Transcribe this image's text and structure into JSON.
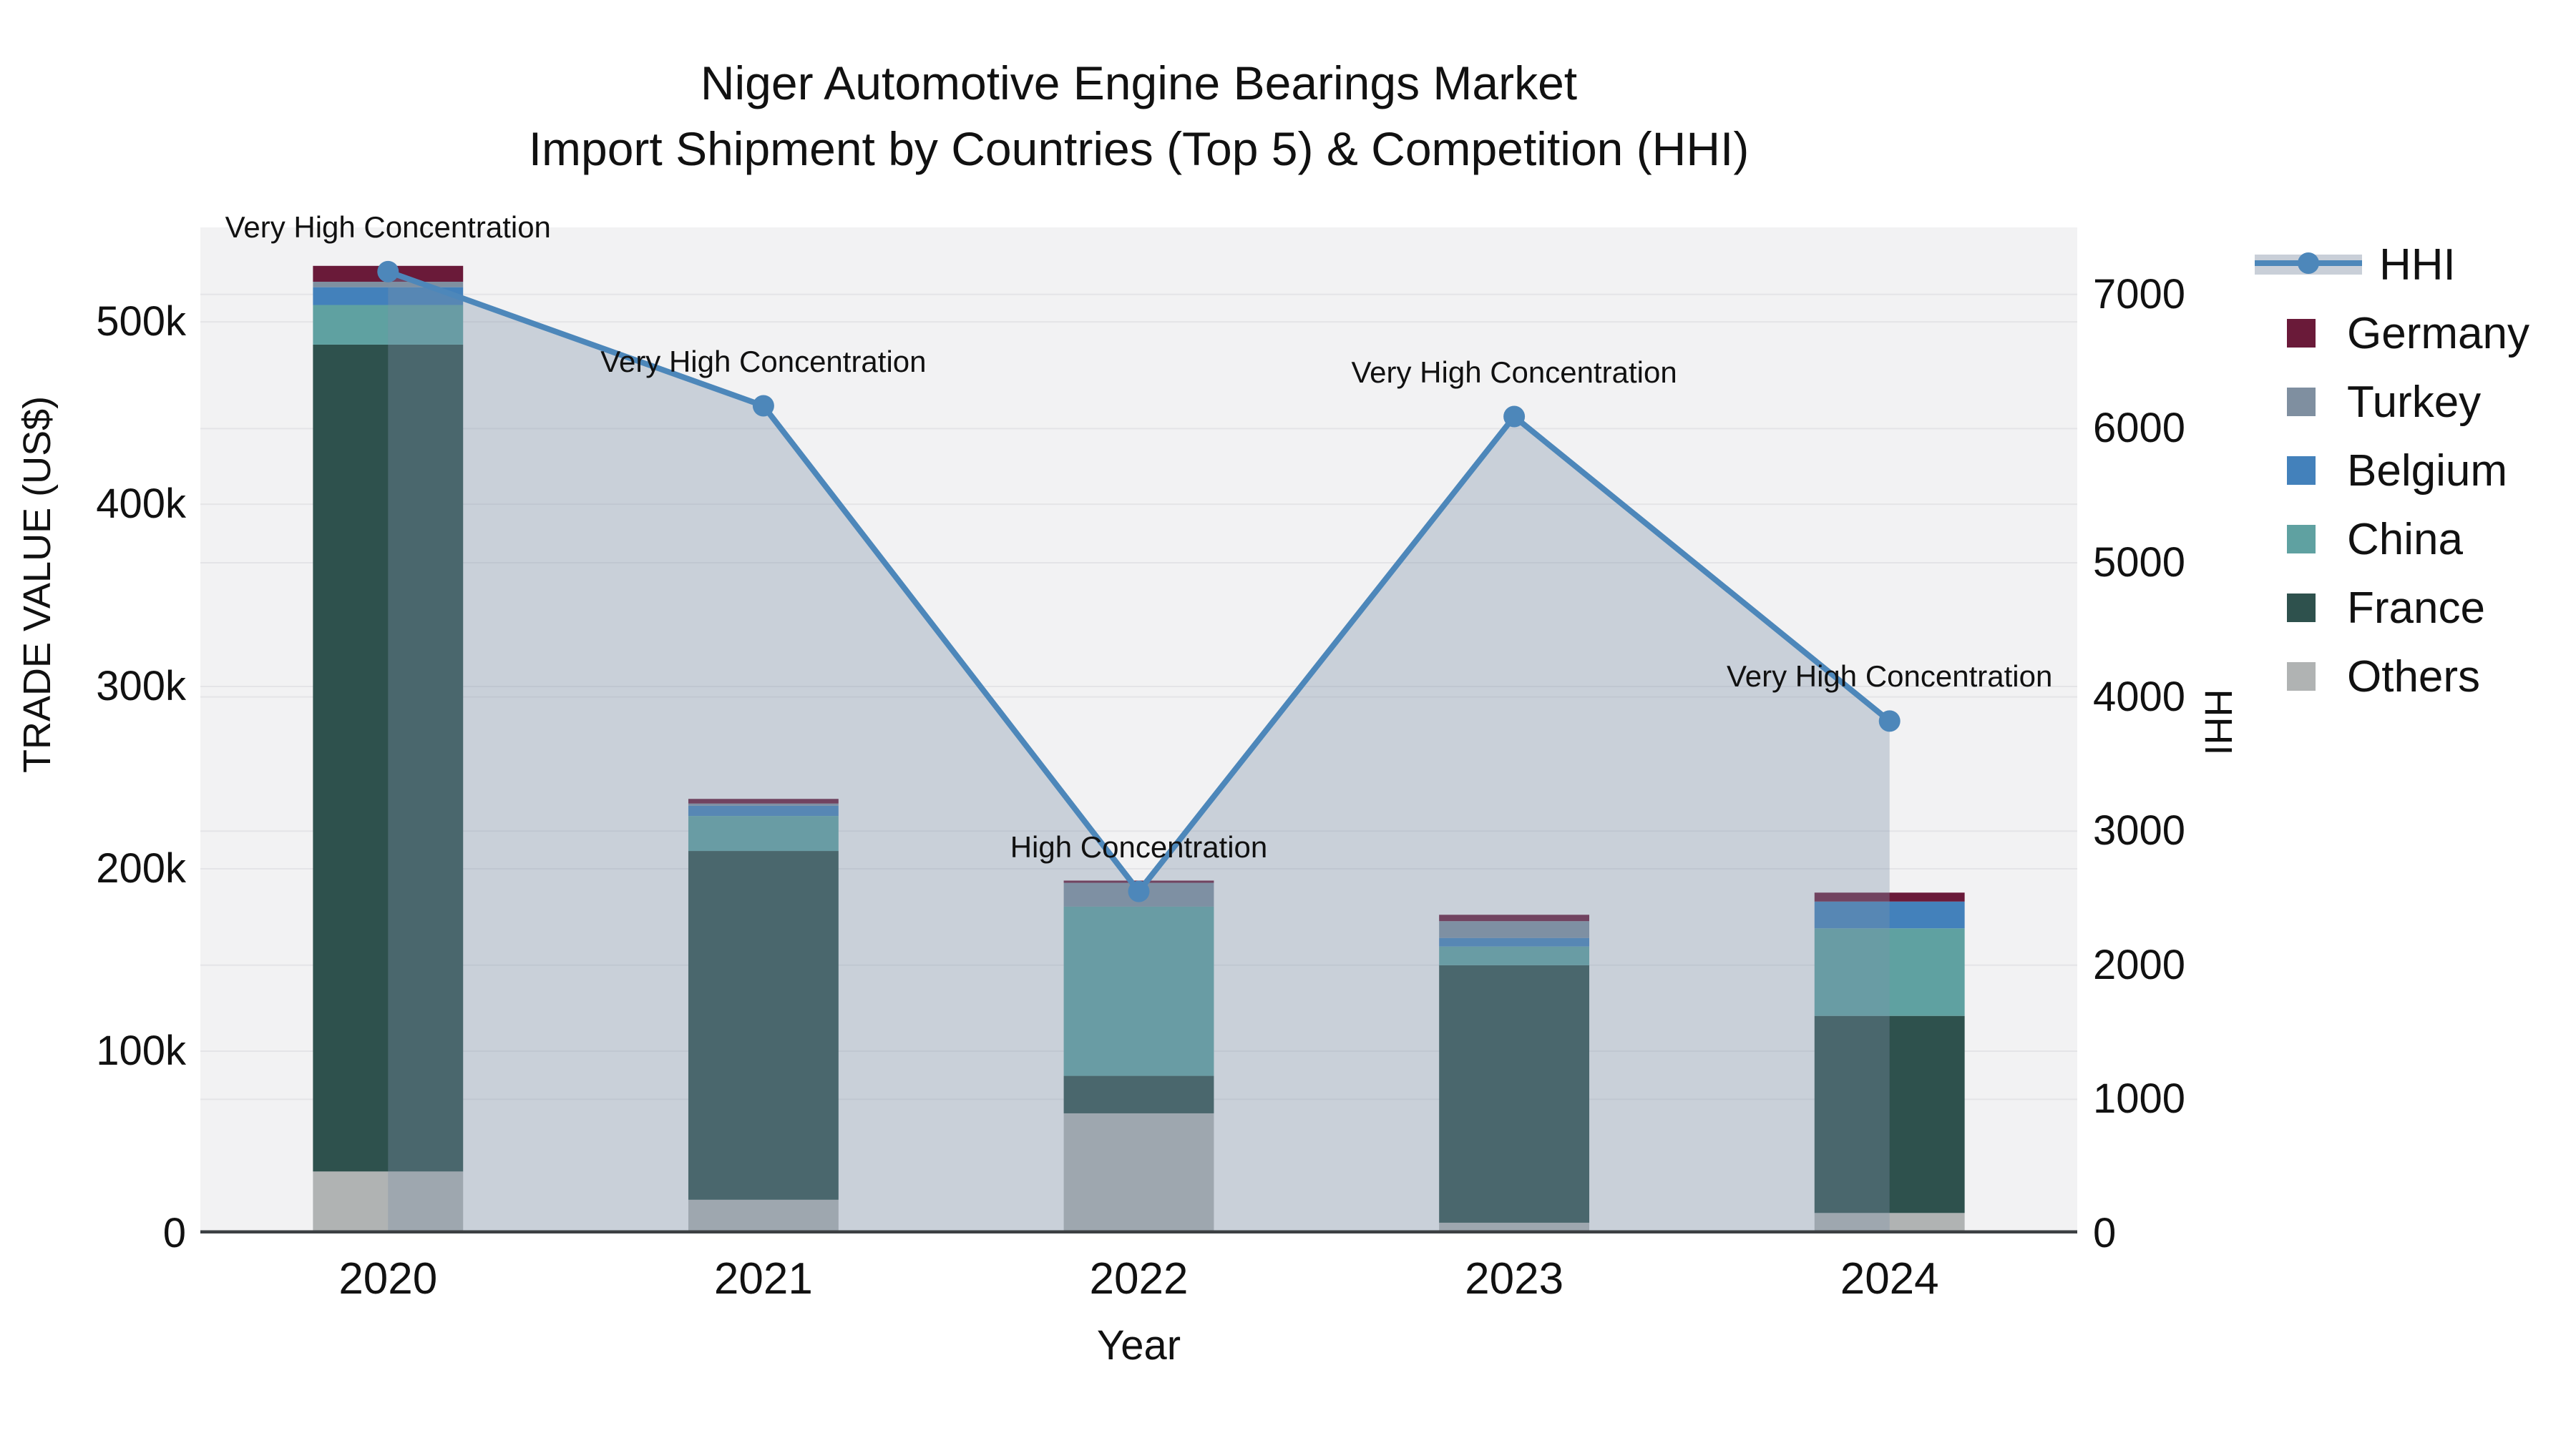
{
  "title": {
    "line1": "Niger Automotive Engine Bearings Market",
    "line2": "Import Shipment by Countries (Top 5) & Competition (HHI)"
  },
  "axes": {
    "x_title": "Year",
    "y_left_title": "TRADE VALUE (US$)",
    "y_right_title": "HHI",
    "y_left_ticks": [
      {
        "label": "0",
        "value": 0
      },
      {
        "label": "100k",
        "value": 100000
      },
      {
        "label": "200k",
        "value": 200000
      },
      {
        "label": "300k",
        "value": 300000
      },
      {
        "label": "400k",
        "value": 400000
      },
      {
        "label": "500k",
        "value": 500000
      }
    ],
    "y_right_ticks": [
      {
        "label": "0",
        "value": 0
      },
      {
        "label": "1000",
        "value": 1000
      },
      {
        "label": "2000",
        "value": 2000
      },
      {
        "label": "3000",
        "value": 3000
      },
      {
        "label": "4000",
        "value": 4000
      },
      {
        "label": "5000",
        "value": 5000
      },
      {
        "label": "6000",
        "value": 6000
      },
      {
        "label": "7000",
        "value": 7000
      }
    ]
  },
  "chart_data": {
    "type": "bar",
    "subtype": "stacked-bars-with-line",
    "categories": [
      "2020",
      "2021",
      "2022",
      "2023",
      "2024"
    ],
    "y_left_range": [
      0,
      551800
    ],
    "y_right_range": [
      0,
      7500
    ],
    "grid": true,
    "legend_position": "right",
    "bar_series_bottom_to_top": [
      {
        "name": "Others",
        "color": "#b0b3b3",
        "values": [
          34000,
          18500,
          65900,
          5900,
          11250
        ]
      },
      {
        "name": "France",
        "color": "#2e514d",
        "values": [
          453500,
          191300,
          20550,
          141200,
          108100
        ]
      },
      {
        "name": "China",
        "color": "#5fa1a1",
        "values": [
          21750,
          19200,
          92800,
          10300,
          48000
        ]
      },
      {
        "name": "Belgium",
        "color": "#4381bb",
        "values": [
          9750,
          5600,
          0,
          4700,
          14700
        ]
      },
      {
        "name": "Turkey",
        "color": "#7f8fa0",
        "values": [
          3000,
          1200,
          13100,
          9200,
          0
        ]
      },
      {
        "name": "Germany",
        "color": "#6a1a39",
        "values": [
          8700,
          2550,
          1200,
          3500,
          4900
        ]
      }
    ],
    "line_series": {
      "name": "HHI",
      "color": "#4d87ba",
      "area_fill": "rgba(125,145,170,0.35)",
      "values": [
        7170,
        6170,
        2550,
        6090,
        3820
      ]
    },
    "annotations": [
      {
        "year": "2020",
        "text": "Very High Concentration"
      },
      {
        "year": "2021",
        "text": "Very High Concentration"
      },
      {
        "year": "2022",
        "text": "High Concentration"
      },
      {
        "year": "2023",
        "text": "Very High Concentration"
      },
      {
        "year": "2024",
        "text": "Very High Concentration"
      }
    ],
    "legend_order": [
      "HHI",
      "Germany",
      "Turkey",
      "Belgium",
      "China",
      "France",
      "Others"
    ]
  },
  "colors": {
    "plot_background": "#f2f2f3",
    "gridline": "#e4e4e7",
    "axis_line": "#3c4043",
    "text": "#111111"
  }
}
